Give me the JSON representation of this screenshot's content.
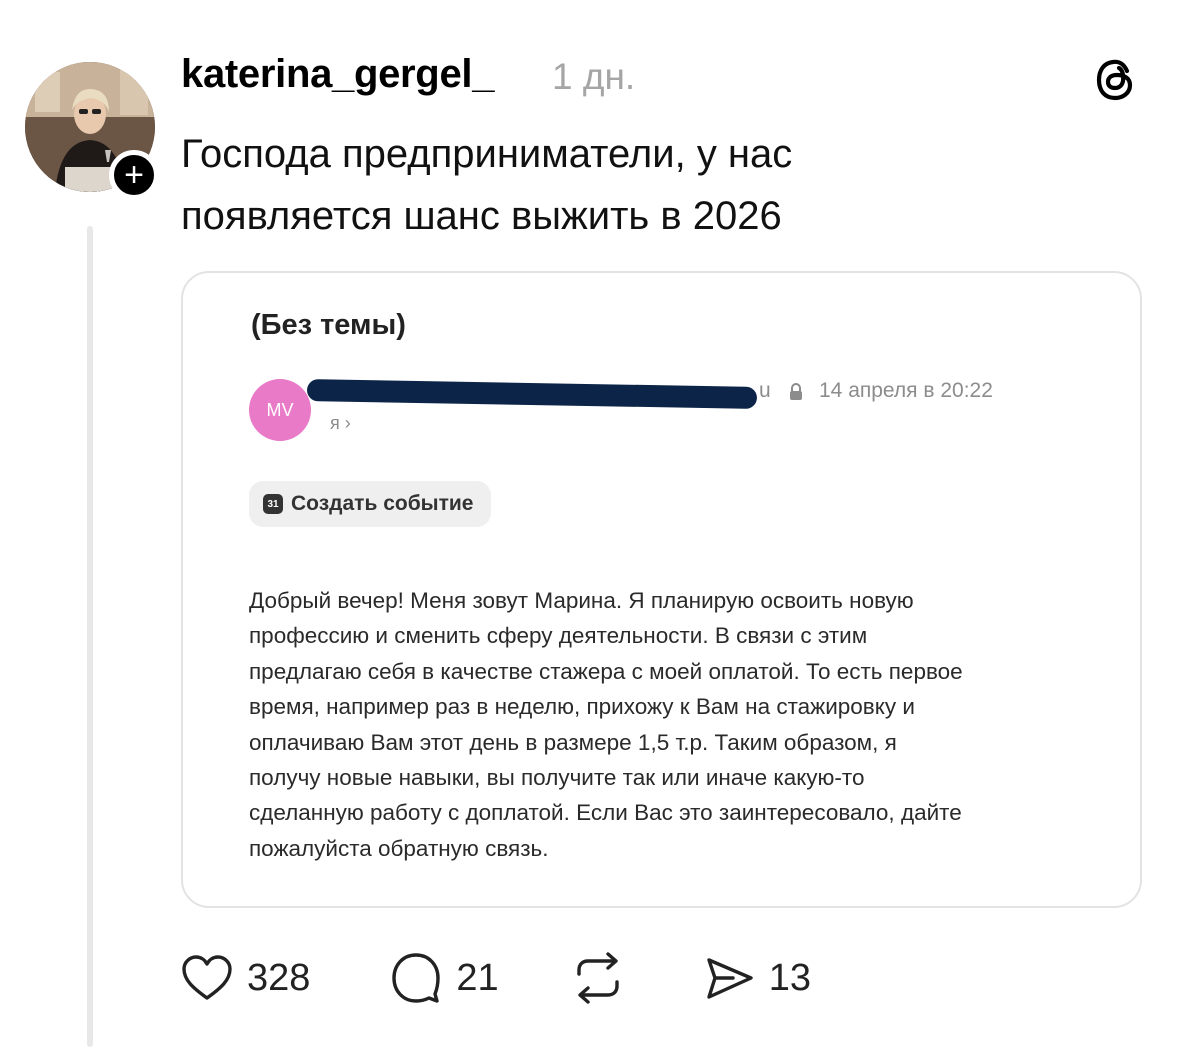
{
  "post": {
    "username": "katerina_gergel_",
    "time": "1 дн.",
    "text_line_1": "Господа предприниматели, у нас",
    "text_line_2": "появляется шанс выжить в 2026",
    "follow_symbol": "+"
  },
  "attachment": {
    "subject": "(Без темы)",
    "sender_initials": "MV",
    "sender_email_tail": "u",
    "date": "14 апреля в 20:22",
    "recipient": "я ›",
    "event_button": "Создать событие",
    "calendar_icon_text": "31",
    "body_lines": [
      "Добрый вечер! Меня зовут Марина. Я планирую освоить новую",
      "профессию и сменить сферу деятельности. В связи с этим",
      "предлагаю себя в качестве стажера с моей оплатой. То есть первое",
      "время, например раз в неделю, прихожу к Вам на стажировку и",
      "оплачиваю Вам этот день в размере 1,5 т.р. Таким образом, я",
      "получу новые навыки, вы получите так или иначе какую-то",
      "сделанную работу с доплатой. Если Вас это заинтересовало, дайте",
      "пожалуйста обратную связь."
    ]
  },
  "actions": {
    "likes": "328",
    "replies": "21",
    "shares": "13"
  },
  "icons": {
    "like": "heart-icon",
    "reply": "speech-bubble-icon",
    "repost": "repost-icon",
    "share": "send-icon",
    "logo": "threads-logo-icon",
    "lock": "lock-icon"
  },
  "colors": {
    "sender_avatar": "#e87ac8",
    "redaction": "#0c2448",
    "muted_text": "#a5a5a5"
  }
}
